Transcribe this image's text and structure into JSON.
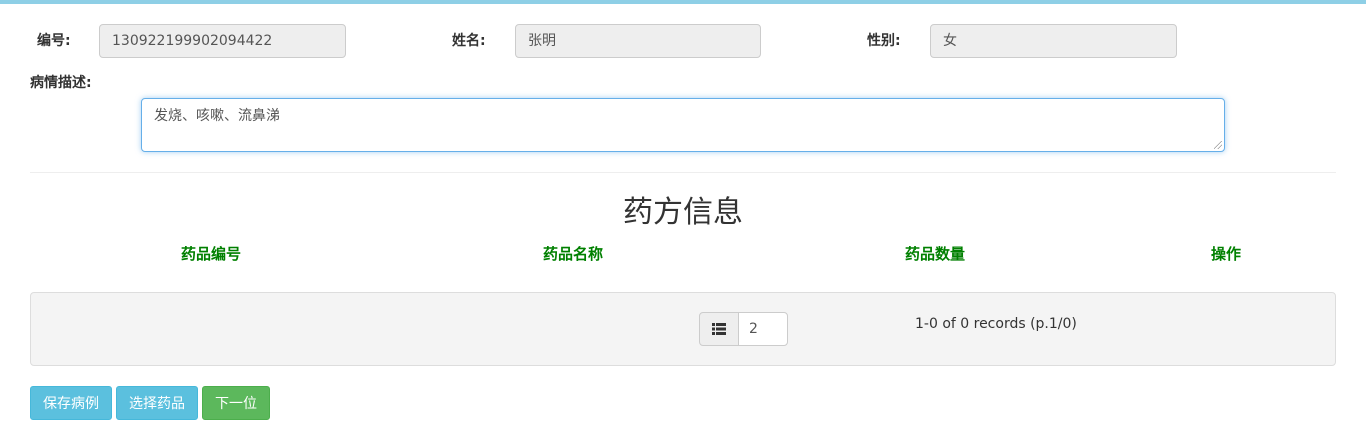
{
  "patient": {
    "id_label": "编号:",
    "id_value": "130922199902094422",
    "name_label": "姓名:",
    "name_value": "张明",
    "gender_label": "性别:",
    "gender_value": "女",
    "desc_label": "病情描述:",
    "desc_value": "发烧、咳嗽、流鼻涕"
  },
  "prescription": {
    "title": "药方信息",
    "columns": [
      "药品编号",
      "药品名称",
      "药品数量",
      "操作"
    ]
  },
  "pager": {
    "page_size": "2",
    "info": "1-0 of 0 records (p.1/0)"
  },
  "actions": {
    "save": "保存病例",
    "select": "选择药品",
    "next": "下一位"
  },
  "colors": {
    "accent": "#5bc0de",
    "success": "#5cb85c",
    "header_green": "#008000"
  }
}
